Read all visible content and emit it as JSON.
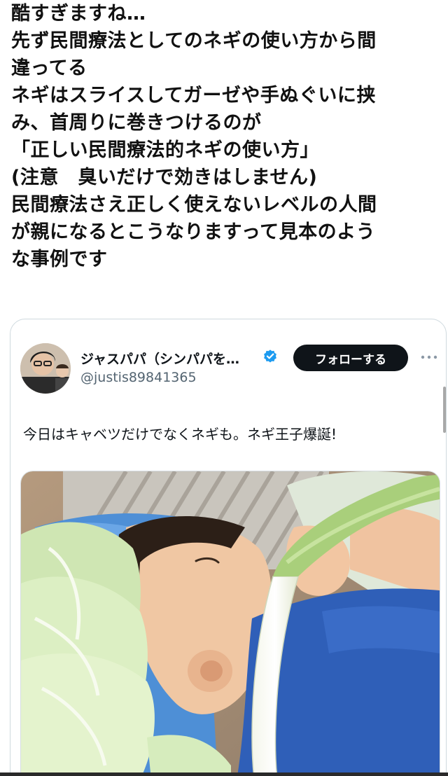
{
  "post": {
    "lines": [
      "酷すぎますね…",
      "先ず民間療法としてのネギの使い方から間",
      "違ってる",
      "ネギはスライスしてガーゼや手ぬぐいに挟",
      "み、首周りに巻きつけるのが",
      "「正しい民間療法的ネギの使い方」",
      "(注意　臭いだけで効きはしません)",
      "民間療法さえ正しく使えないレベルの人間",
      "が親になるとこうなりますって見本のよう",
      "な事例です"
    ]
  },
  "quoted_tweet": {
    "display_name": "ジャスパパ（シンパパを…",
    "handle": "@justis89841365",
    "verified_icon": "verified-badge-icon",
    "follow_label": "フォローする",
    "more_icon": "more-dots-icon",
    "text": "今日はキャベツだけでなくネギも。ネギ王子爆誕!",
    "photo_icon": "photo-child-cabbage-leek"
  },
  "colors": {
    "follow_bg": "#0f1419",
    "verified": "#1d9bf0",
    "handle": "#536471",
    "card_border": "#cfd9de"
  }
}
